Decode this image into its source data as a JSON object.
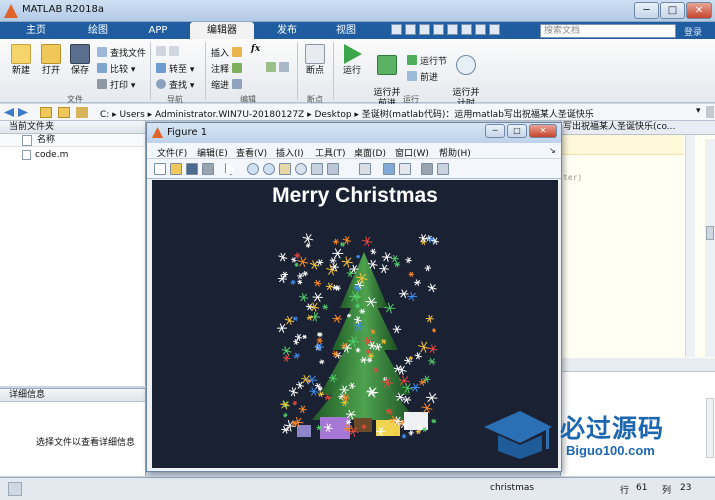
{
  "window": {
    "title": "MATLAB R2018a",
    "minimize": "─",
    "maximize": "□",
    "close": "✕"
  },
  "tabs": [
    {
      "label": "主页"
    },
    {
      "label": "绘图"
    },
    {
      "label": "APP"
    },
    {
      "label": "编辑器"
    },
    {
      "label": "发布"
    },
    {
      "label": "视图"
    }
  ],
  "search": {
    "placeholder": "搜索文档",
    "login": "登录"
  },
  "ribbon": {
    "new": "新建",
    "open": "打开",
    "save": "保存",
    "find_files": "查找文件",
    "compare": "比较",
    "print": "打印",
    "goto": "转至",
    "find": "查找",
    "insert": "插入",
    "comment": "注释",
    "indent": "缩进",
    "fx": "fx",
    "breakpoints": "断点",
    "run": "运行",
    "run_advance": "运行并\n前进",
    "run_section": "运行节",
    "advance": "前进",
    "run_time": "运行并\n计时",
    "groups": {
      "file": "文件",
      "navigate": "导航",
      "edit": "编辑",
      "breakpoint": "断点",
      "run": "运行"
    }
  },
  "address": {
    "path": "C: ▸ Users ▸ Administrator.WIN7U-20180127Z ▸ Desktop ▸ 圣诞树(matlab代码)：运用matlab写出祝福某人圣诞快乐",
    "right_title": "写出祝福某人圣诞快乐(co..."
  },
  "current_folder": {
    "title": "当前文件夹",
    "name_col": "名称",
    "files": [
      "code.m"
    ]
  },
  "details": {
    "title": "详细信息",
    "hint": "选择文件以查看详细信息"
  },
  "editor_snippet": "ter)",
  "figure": {
    "title": "Figure 1",
    "menu": [
      "文件(F)",
      "编辑(E)",
      "查看(V)",
      "插入(I)",
      "工具(T)",
      "桌面(D)",
      "窗口(W)",
      "帮助(H)"
    ],
    "plot_title": "Merry Christmas"
  },
  "status": {
    "text": "christmas",
    "row_label": "行",
    "row": "61",
    "col_label": "列",
    "col": "23"
  },
  "watermark": {
    "brand": "必过源码",
    "url": "Biguo100.com"
  },
  "colors": {
    "tab_bg": "#1f5da0",
    "axes_bg": "#1a2133",
    "tree": "#2d7a33",
    "ribbon_bg": "#f2f2f2"
  }
}
